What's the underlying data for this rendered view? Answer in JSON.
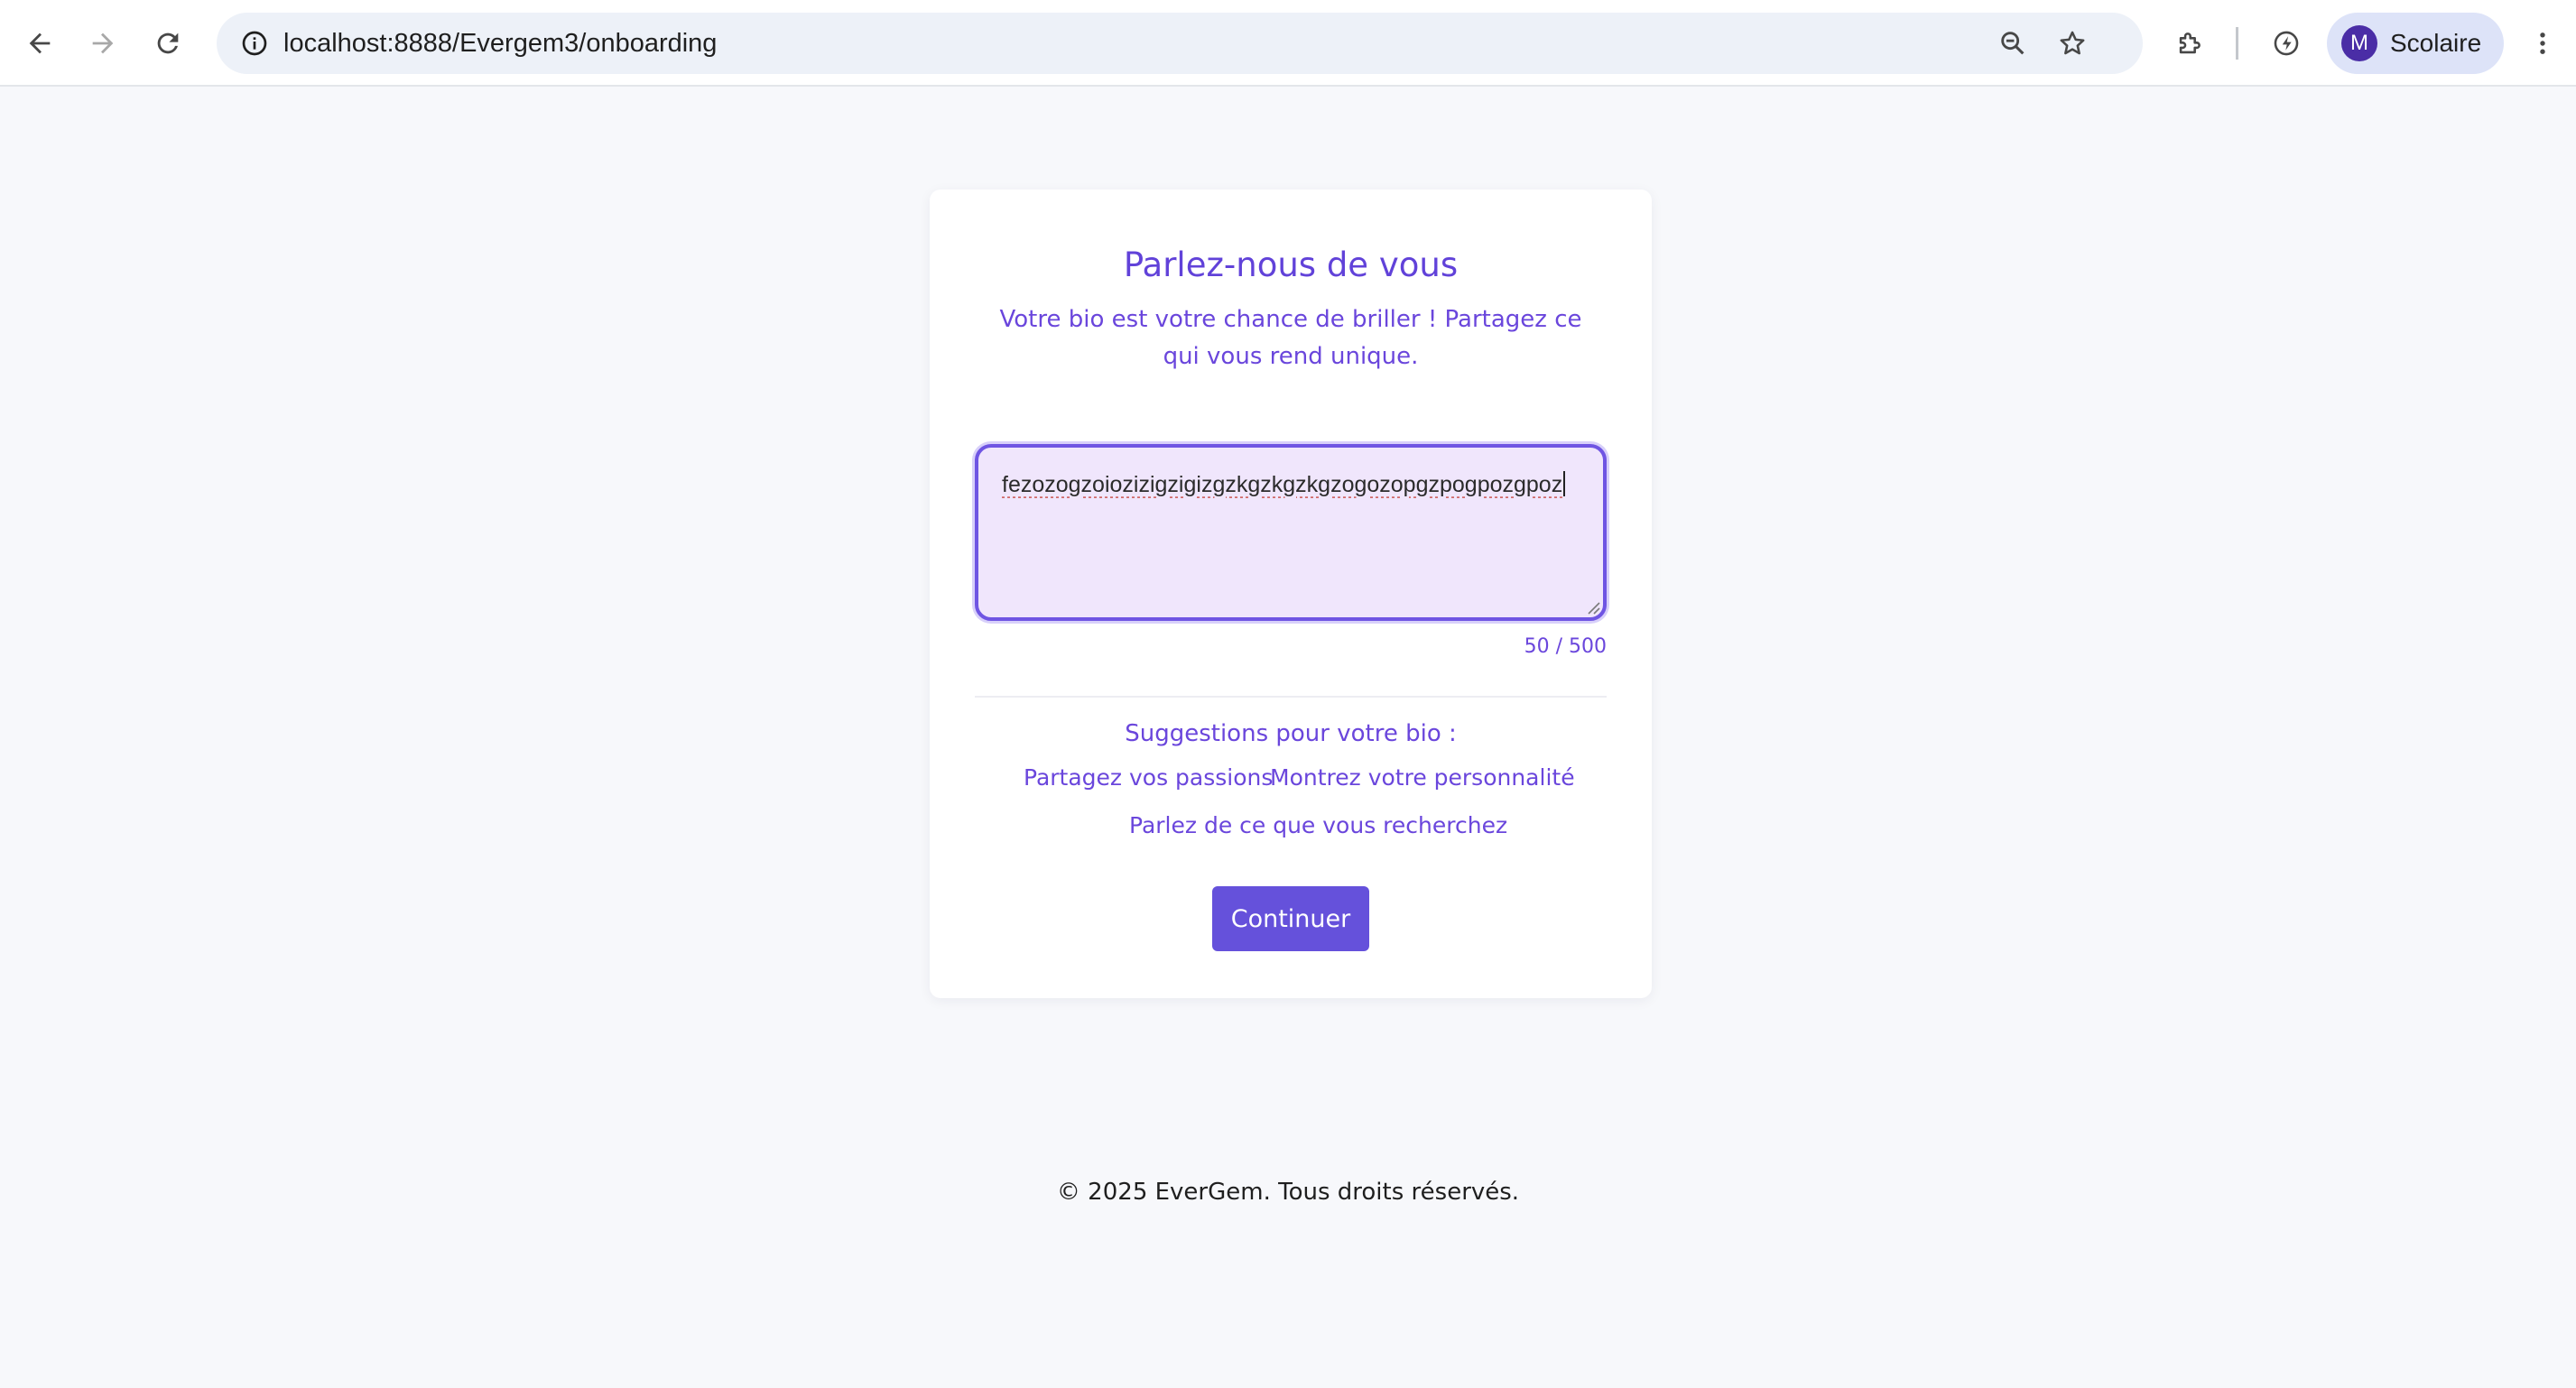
{
  "browser": {
    "url": "localhost:8888/Evergem3/onboarding",
    "profile_initial": "M",
    "profile_name": "Scolaire",
    "icons": [
      "back-arrow-icon",
      "forward-arrow-icon",
      "reload-icon",
      "site-info-icon",
      "zoom-icon",
      "bookmark-star-icon",
      "extensions-puzzle-icon",
      "performance-icon",
      "kebab-menu-icon"
    ]
  },
  "onboarding": {
    "title": "Parlez-nous de vous",
    "subtitle": "Votre bio est votre chance de briller ! Partagez ce qui vous rend unique.",
    "bio_value": "fezozogzoiozizigzigizgzkgzkgzkgzogozopgzpogpozgpoz",
    "char_count": "50 / 500",
    "suggestions_title": "Suggestions pour votre bio :",
    "suggestions": [
      "Partagez vos passions",
      "Montrez votre personnalité",
      "Parlez de ce que vous recherchez"
    ],
    "continue_label": "Continuer"
  },
  "footer": {
    "text": "© 2025 EverGem. Tous droits réservés."
  },
  "colors": {
    "accent": "#6551db",
    "heading": "#6142d9",
    "textarea_bg": "#f0e6fc",
    "page_bg": "#f7f8fb"
  }
}
